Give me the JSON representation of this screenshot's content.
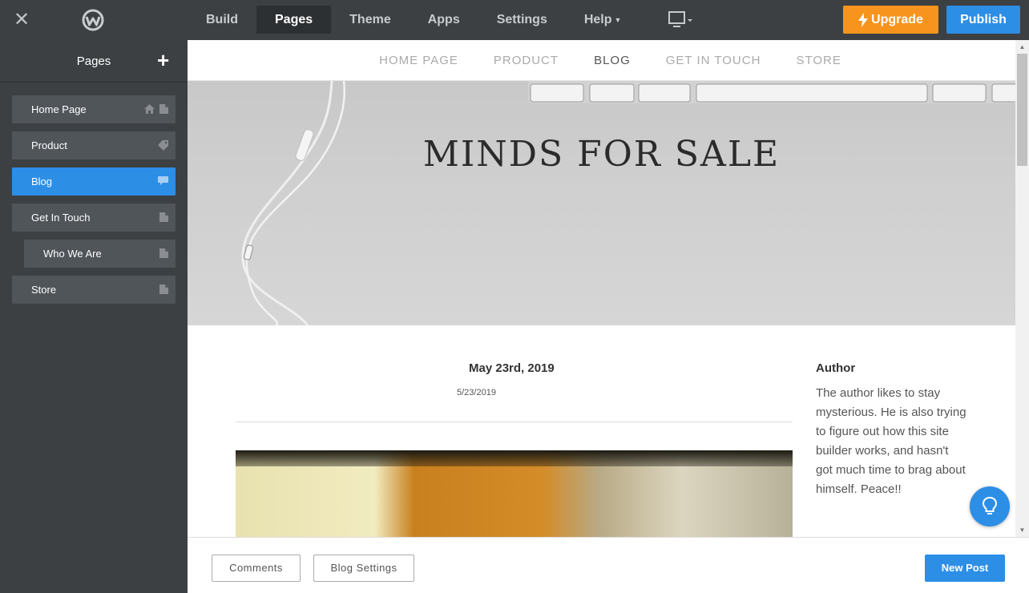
{
  "topbar": {
    "nav": [
      {
        "label": "Build"
      },
      {
        "label": "Pages"
      },
      {
        "label": "Theme"
      },
      {
        "label": "Apps"
      },
      {
        "label": "Settings"
      },
      {
        "label": "Help"
      }
    ],
    "upgrade_label": "Upgrade",
    "publish_label": "Publish"
  },
  "sidebar": {
    "title": "Pages",
    "pages": [
      {
        "label": "Home Page"
      },
      {
        "label": "Product"
      },
      {
        "label": "Blog"
      },
      {
        "label": "Get In Touch"
      },
      {
        "label": "Who We Are"
      },
      {
        "label": "Store"
      }
    ]
  },
  "site": {
    "nav": [
      "HOME PAGE",
      "PRODUCT",
      "BLOG",
      "GET IN TOUCH",
      "STORE"
    ],
    "hero_title": "MINDS FOR SALE",
    "post": {
      "date_title": "May 23rd, 2019",
      "date_small": "5/23/2019"
    },
    "author": {
      "heading": "Author",
      "bio": "The author likes to stay mysterious. He is also trying to figure out how this site builder works, and hasn't got much time to brag about himself. Peace!!"
    }
  },
  "bottombar": {
    "comments_label": "Comments",
    "blog_settings_label": "Blog Settings",
    "new_post_label": "New Post"
  },
  "colors": {
    "accent": "#2d8ee6",
    "upgrade": "#f7941d",
    "chrome": "#3c4043"
  }
}
